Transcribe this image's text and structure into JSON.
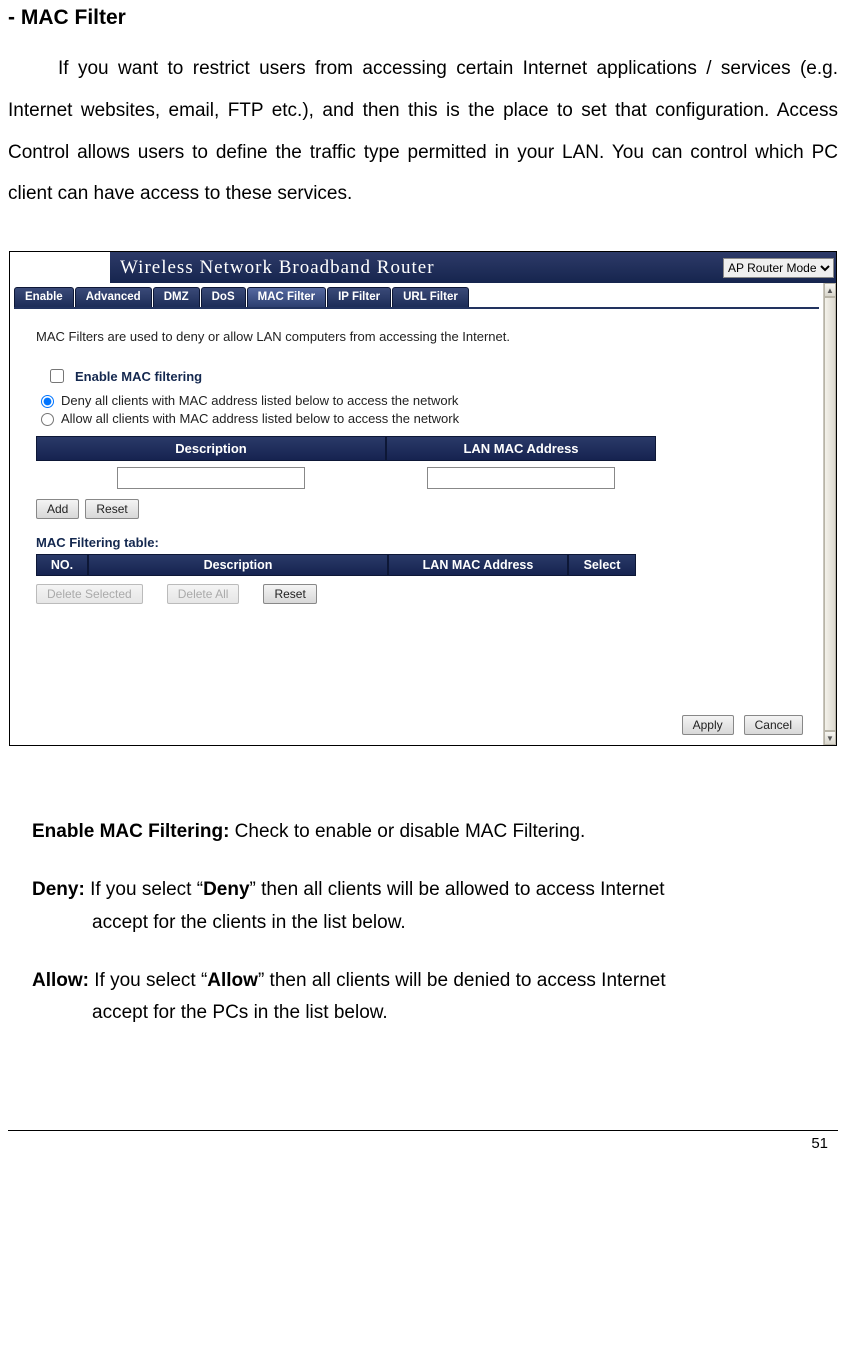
{
  "doc": {
    "heading": "- MAC Filter",
    "intro": "If you want to restrict users from accessing certain Internet applications / services (e.g. Internet websites, email, FTP etc.), and then this is the place to set that configuration. Access Control allows users to define the traffic type permitted in your LAN. You can control which PC client can have access to these services.",
    "defs": {
      "enable_label": "Enable MAC Filtering:",
      "enable_text": " Check to enable or disable MAC Filtering.",
      "deny_label": "Deny:",
      "deny_text_1": " If you select “",
      "deny_bold": "Deny",
      "deny_text_2": "” then all clients will be allowed to access Internet",
      "deny_text_cont": "accept for the clients in the list below.",
      "allow_label": "Allow:",
      "allow_text_1": " If you select “",
      "allow_bold": "Allow",
      "allow_text_2": "” then all clients will be denied to access Internet",
      "allow_text_cont": "accept for the PCs in the list below."
    },
    "page_number": "51"
  },
  "router": {
    "title": "Wireless Network Broadband Router",
    "mode": "AP Router Mode",
    "tabs": [
      "Enable",
      "Advanced",
      "DMZ",
      "DoS",
      "MAC Filter",
      "IP Filter",
      "URL Filter"
    ],
    "active_tab_index": 4,
    "desc": "MAC Filters are used to deny or allow LAN computers from accessing the Internet.",
    "enable_checkbox_label": "Enable MAC filtering",
    "radio_deny": "Deny all clients with MAC address listed below to access the network",
    "radio_allow": "Allow all clients with MAC address listed below to access the network",
    "headers": {
      "description": "Description",
      "mac": "LAN MAC Address"
    },
    "buttons": {
      "add": "Add",
      "reset": "Reset",
      "delete_selected": "Delete Selected",
      "delete_all": "Delete All",
      "reset2": "Reset",
      "apply": "Apply",
      "cancel": "Cancel"
    },
    "table_title": "MAC Filtering table:",
    "table_headers": {
      "no": "NO.",
      "description": "Description",
      "mac": "LAN MAC Address",
      "select": "Select"
    }
  }
}
